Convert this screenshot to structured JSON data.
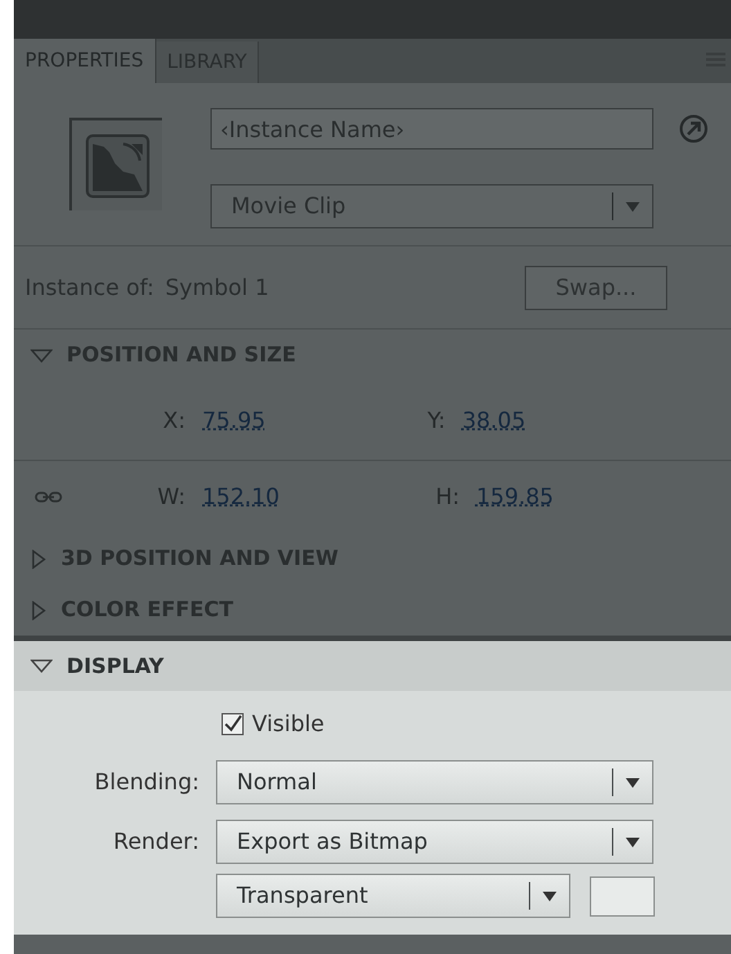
{
  "tabs": [
    {
      "label": "PROPERTIES",
      "selected": true
    },
    {
      "label": "LIBRARY",
      "selected": false
    }
  ],
  "instance": {
    "name_placeholder": "‹Instance Name›",
    "type": "Movie Clip",
    "instance_of_label": "Instance of:",
    "instance_of_value": "Symbol 1",
    "swap_button": "Swap..."
  },
  "sections": [
    {
      "kind": "position",
      "title": "POSITION AND SIZE",
      "expanded": true,
      "highlighted": false,
      "rows": [
        {
          "linked": false,
          "fields": [
            {
              "label": "X:",
              "value": "75.95"
            },
            {
              "label": "Y:",
              "value": "38.05"
            }
          ]
        },
        {
          "linked": true,
          "fields": [
            {
              "label": "W:",
              "value": "152.10"
            },
            {
              "label": "H:",
              "value": "159.85"
            }
          ]
        }
      ]
    },
    {
      "kind": "plain",
      "title": "3D POSITION AND VIEW",
      "expanded": false,
      "highlighted": false
    },
    {
      "kind": "plain",
      "title": "COLOR EFFECT",
      "expanded": false,
      "highlighted": false
    },
    {
      "kind": "display",
      "title": "DISPLAY",
      "expanded": true,
      "highlighted": true,
      "visible": {
        "label": "Visible",
        "checked": true
      },
      "blending": {
        "label": "Blending:",
        "value": "Normal"
      },
      "render": {
        "label": "Render:",
        "value": "Export as Bitmap"
      },
      "background": {
        "value": "Transparent"
      }
    }
  ]
}
